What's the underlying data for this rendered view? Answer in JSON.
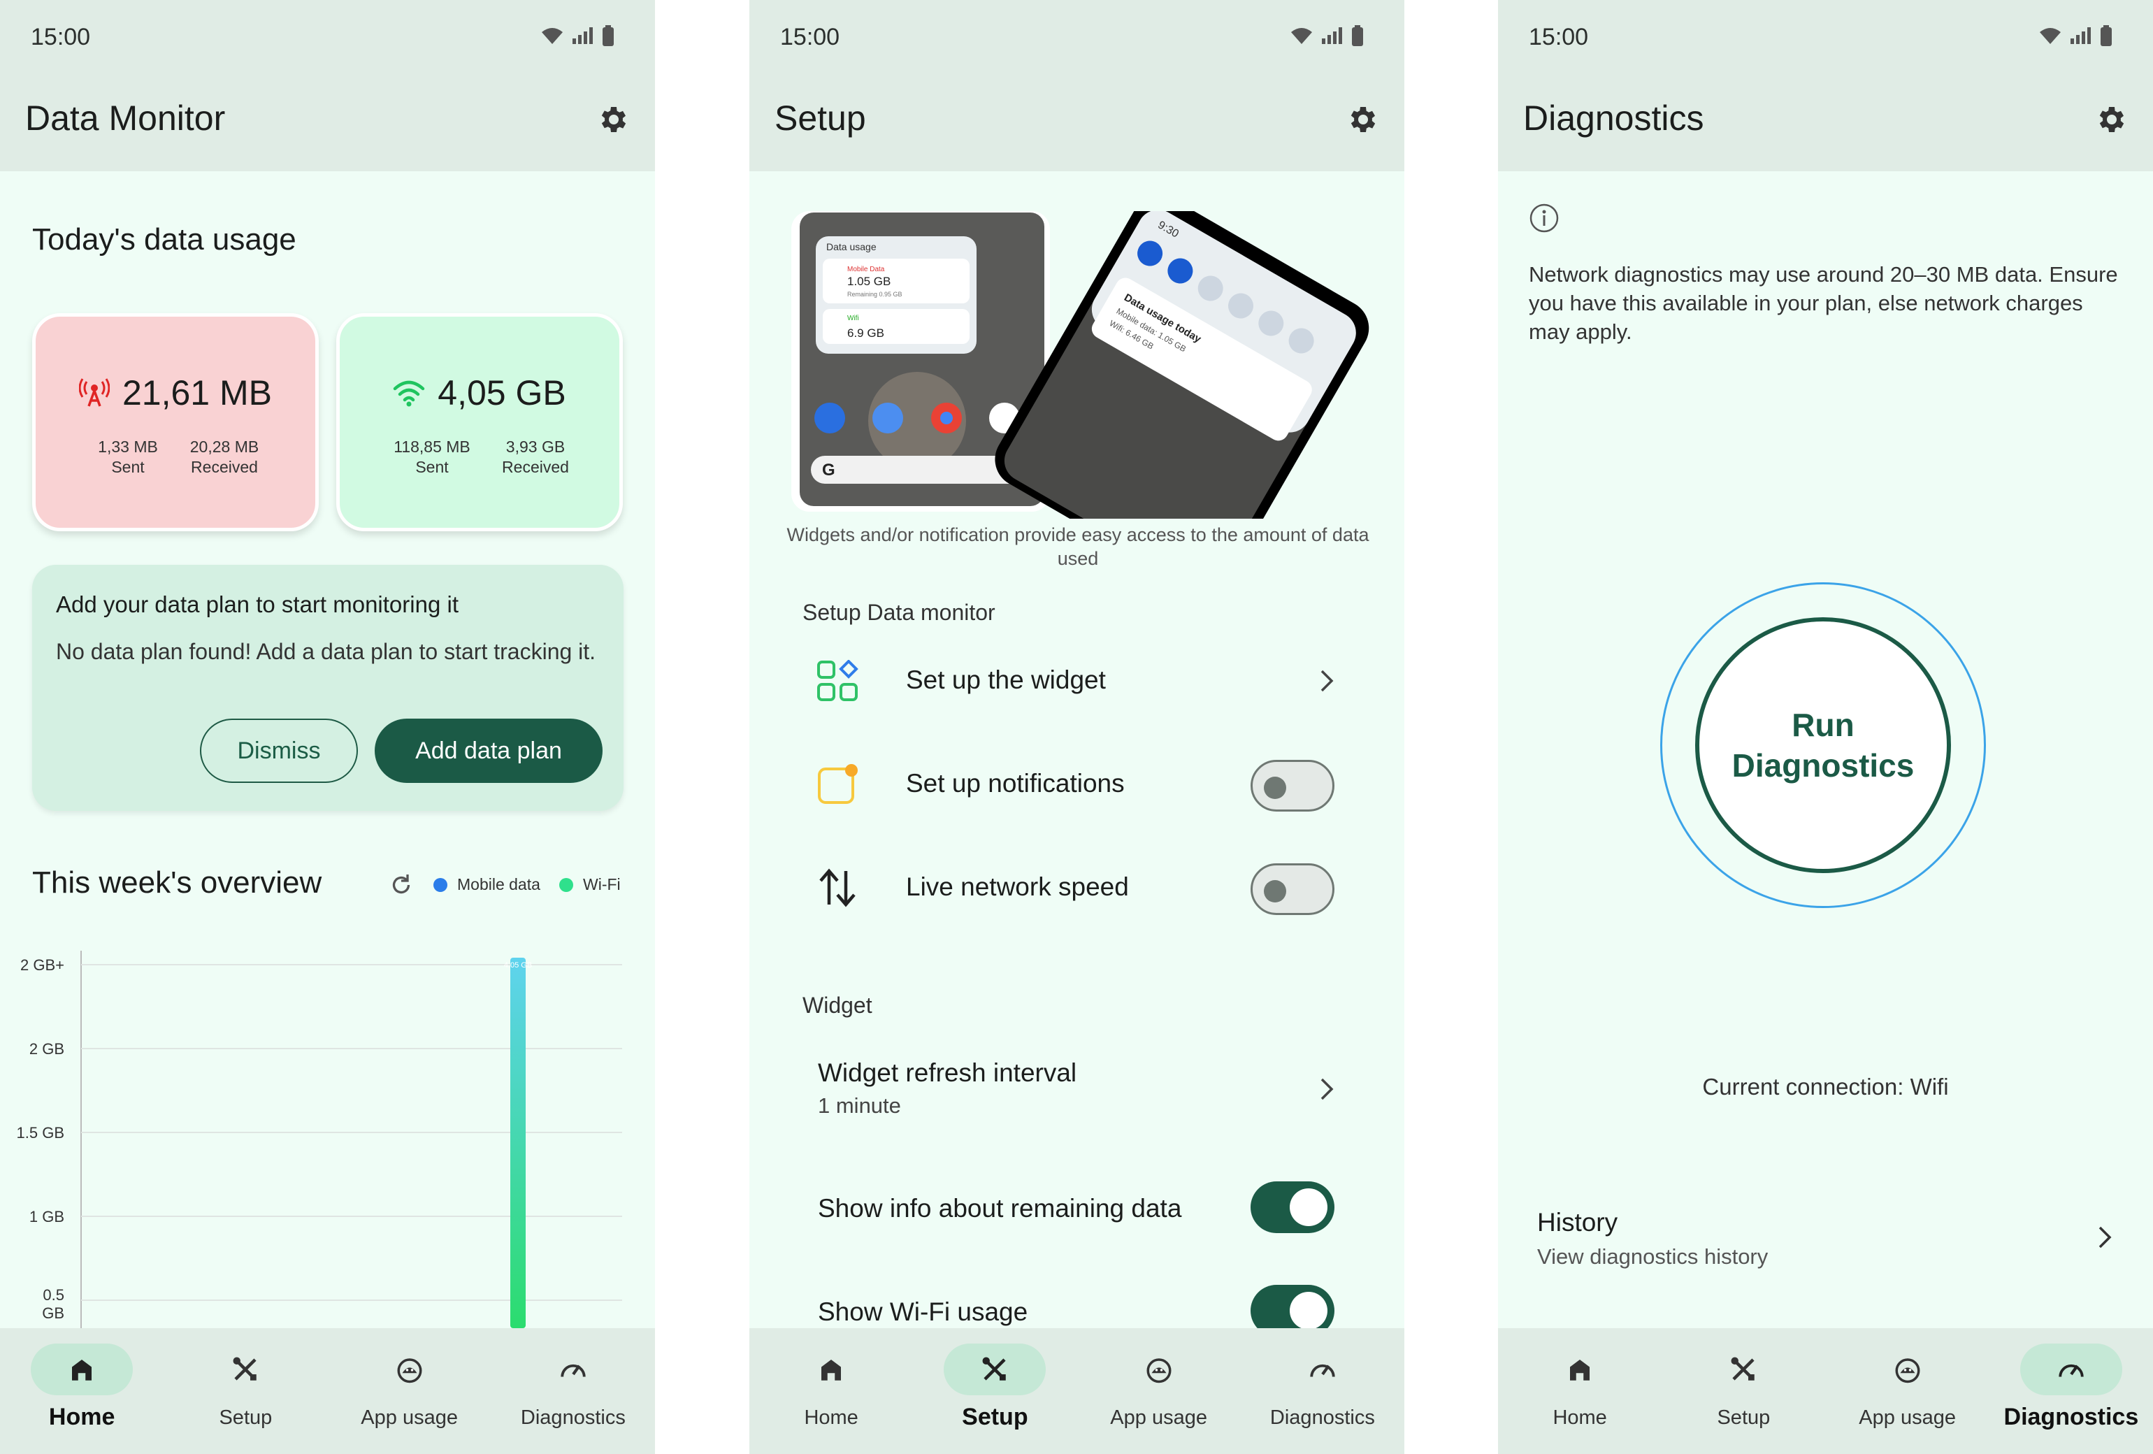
{
  "status": {
    "time": "15:00"
  },
  "nav": {
    "home": "Home",
    "setup": "Setup",
    "app_usage": "App usage",
    "diagnostics": "Diagnostics"
  },
  "home": {
    "title": "Data Monitor",
    "today_heading": "Today's data usage",
    "mobile": {
      "total": "21,61 MB",
      "sent": "1,33 MB",
      "sent_label": "Sent",
      "received": "20,28 MB",
      "received_label": "Received"
    },
    "wifi": {
      "total": "4,05 GB",
      "sent": "118,85 MB",
      "sent_label": "Sent",
      "received": "3,93 GB",
      "received_label": "Received"
    },
    "plan": {
      "title": "Add your data plan to start monitoring it",
      "text": "No data plan found! Add a data plan to start tracking it.",
      "dismiss": "Dismiss",
      "add": "Add data plan"
    },
    "week_heading": "This week's overview",
    "legend_mobile": "Mobile data",
    "legend_wifi": "Wi-Fi"
  },
  "chart_data": {
    "type": "bar",
    "title": "This week's overview",
    "y_tick_labels": [
      "2 GB+",
      "2 GB",
      "1.5 GB",
      "1 GB",
      "0.5 GB"
    ],
    "series": [
      {
        "name": "Wi-Fi",
        "values": [
          4.05
        ]
      },
      {
        "name": "Mobile data",
        "values": [
          0.02
        ]
      }
    ],
    "bar_label": "4.05 GB",
    "colors": {
      "mobile": "#2b7de9",
      "wifi_top": "#5fd3ee",
      "wifi_bottom": "#2bdc6e"
    },
    "grid": true,
    "legend": "top-right"
  },
  "setup": {
    "title": "Setup",
    "caption": "Widgets and/or notification provide easy access to the amount of data used",
    "section_setup": "Setup Data monitor",
    "widget_row": "Set up the widget",
    "notifications_row": "Set up notifications",
    "speed_row": "Live network speed",
    "section_widget": "Widget",
    "refresh_label": "Widget refresh interval",
    "refresh_value": "1 minute",
    "remaining_label": "Show info about remaining data",
    "wifi_usage_label": "Show Wi-Fi usage",
    "illus": {
      "widget_header": "Data usage",
      "widget_mobile": "Mobile Data",
      "widget_mobile_value": "1.05 GB",
      "widget_remaining": "Remaining 0.95 GB",
      "widget_wifi": "Wifi",
      "widget_wifi_value": "6.9 GB",
      "notif_time": "9:30",
      "notif_title": "Data usage today",
      "notif_line1": "Mobile data: 1.05 GB",
      "notif_line2": "Wifi: 6.46 GB"
    }
  },
  "diag": {
    "title": "Diagnostics",
    "note": "Network diagnostics may use around 20–30 MB data. Ensure you have this available in your plan, else network charges may apply.",
    "run_line1": "Run",
    "run_line2": "Diagnostics",
    "connection": "Current connection: Wifi",
    "history_title": "History",
    "history_sub": "View diagnostics history"
  },
  "colors": {
    "accent": "#1b5a46",
    "bar_bg": "#e0ece5",
    "page_bg": "#effdf6"
  }
}
